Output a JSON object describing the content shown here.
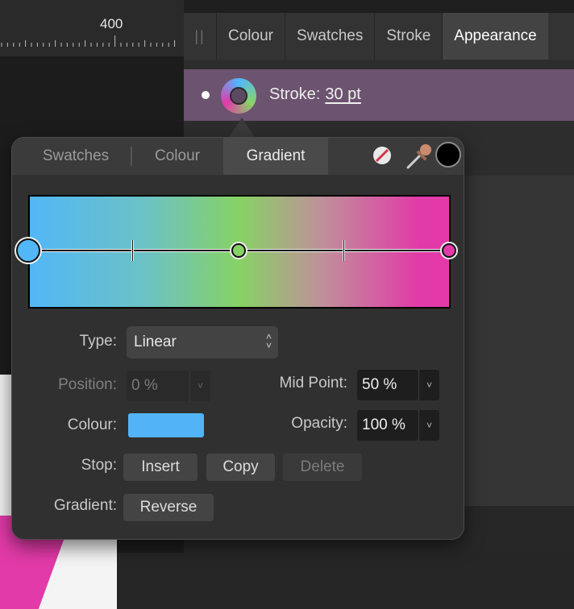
{
  "ruler": {
    "label": "400"
  },
  "panel_tabs": [
    "Colour",
    "Swatches",
    "Stroke",
    "Appearance"
  ],
  "active_panel_tab": "Appearance",
  "stroke_row": {
    "label": "Stroke:",
    "value": "30 pt"
  },
  "popover": {
    "tabs": [
      "Swatches",
      "Colour",
      "Gradient"
    ],
    "active_tab": "Gradient",
    "gradient": {
      "colors": [
        "#52b7f6",
        "#87d264",
        "#e23aa8"
      ],
      "stops": [
        0,
        0.5,
        1
      ],
      "midpoints": [
        0.25,
        0.75
      ],
      "selected_stop": 0
    },
    "type": {
      "label": "Type:",
      "value": "Linear"
    },
    "position": {
      "label": "Position:",
      "value": "0 %"
    },
    "mid_point": {
      "label": "Mid Point:",
      "value": "50 %"
    },
    "colour": {
      "label": "Colour:",
      "swatch": "#52b4f6"
    },
    "opacity": {
      "label": "Opacity:",
      "value": "100 %"
    },
    "stop": {
      "label": "Stop:",
      "insert": "Insert",
      "copy": "Copy",
      "delete": "Delete"
    },
    "gradient_row": {
      "label": "Gradient:",
      "reverse": "Reverse"
    }
  },
  "icons": {
    "no_fill": "no-fill-icon",
    "picker": "colour-picker-icon",
    "chevron": "chevron-down-icon",
    "stepper": "up-down-stepper-icon"
  }
}
